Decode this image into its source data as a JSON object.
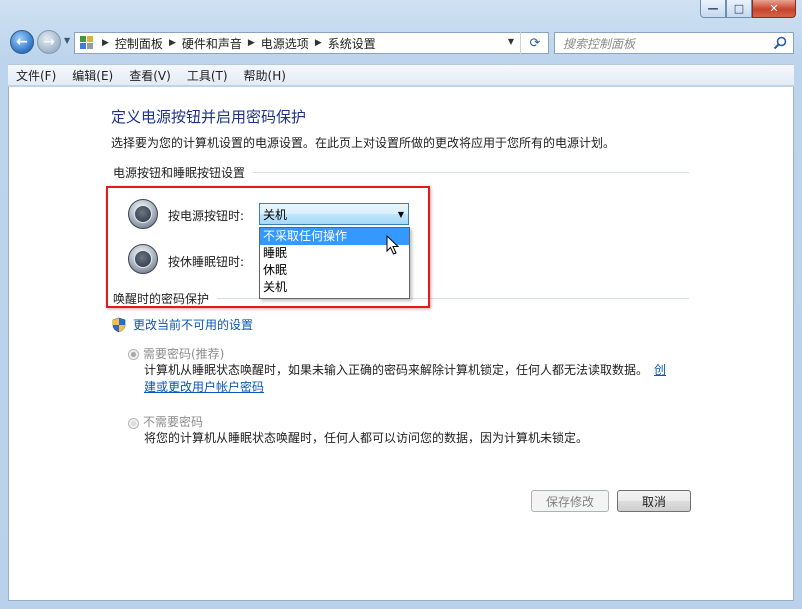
{
  "window": {
    "caption": {
      "minimize": "—",
      "maximize": "□",
      "close": "✕"
    }
  },
  "nav": {
    "breadcrumbs": [
      "控制面板",
      "硬件和声音",
      "电源选项",
      "系统设置"
    ],
    "search_placeholder": "搜索控制面板"
  },
  "menu": [
    "文件(F)",
    "编辑(E)",
    "查看(V)",
    "工具(T)",
    "帮助(H)"
  ],
  "page": {
    "title": "定义电源按钮并启用密码保护",
    "description": "选择要为您的计算机设置的电源设置。在此页上对设置所做的更改将应用于您所有的电源计划。"
  },
  "power_section": {
    "heading": "电源按钮和睡眠按钮设置",
    "power_button_label": "按电源按钮时:",
    "sleep_button_label": "按休睡眠钮时:",
    "power_button_value": "关机",
    "dropdown_options": [
      "不采取任何操作",
      "睡眠",
      "休眠",
      "关机"
    ],
    "highlighted_option": "不采取任何操作"
  },
  "wake_section": {
    "heading": "唤醒时的密码保护",
    "change_link": "更改当前不可用的设置",
    "require_password": {
      "label": "需要密码(推荐)",
      "checked": true,
      "desc_line1": "计算机从睡眠状态唤醒时，如果未输入正确的密码来解除计算机锁定，任何人都无法读取数据。",
      "link_part1": "创",
      "link_part2": "建或更改用户帐户密码"
    },
    "no_password": {
      "label": "不需要密码",
      "checked": false,
      "desc": "将您的计算机从睡眠状态唤醒时，任何人都可以访问您的数据，因为计算机未锁定。"
    }
  },
  "buttons": {
    "save": "保存修改",
    "cancel": "取消"
  },
  "colors": {
    "title_blue": "#1e3287",
    "link_blue": "#0b57b3",
    "highlight": "#3399ff",
    "annotation_red": "#e01b1b"
  }
}
